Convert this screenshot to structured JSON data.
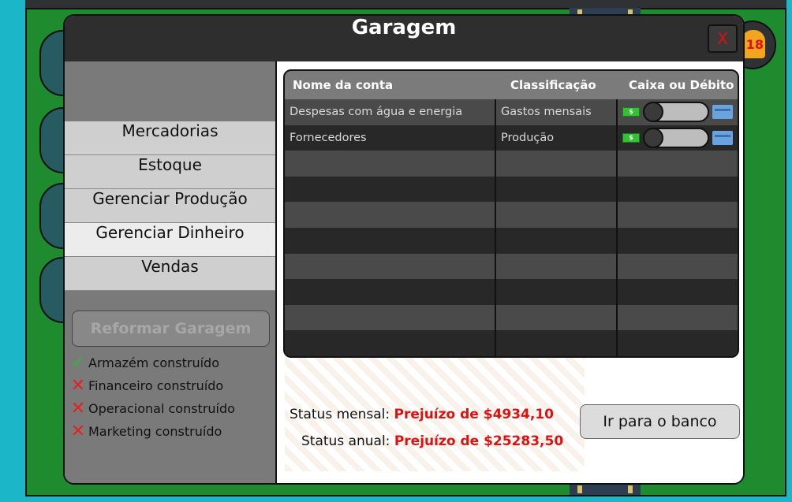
{
  "modal": {
    "title": "Garagem",
    "close_label": "X"
  },
  "notification": {
    "count": "18"
  },
  "sidebar": {
    "menu": [
      {
        "label": "Mercadorias",
        "active": false
      },
      {
        "label": "Estoque",
        "active": false
      },
      {
        "label": "Gerenciar Produção",
        "active": false
      },
      {
        "label": "Gerenciar Dinheiro",
        "active": true
      },
      {
        "label": "Vendas",
        "active": false
      }
    ],
    "reform_button": "Reformar Garagem",
    "checklist": [
      {
        "label": "Armazém construído",
        "done": true
      },
      {
        "label": "Financeiro construído",
        "done": false
      },
      {
        "label": "Operacional construído",
        "done": false
      },
      {
        "label": "Marketing construído",
        "done": false
      }
    ]
  },
  "accounts_table": {
    "headers": [
      "Nome da conta",
      "Classificação",
      "Caixa ou Débito"
    ],
    "rows": [
      {
        "name": "Despesas com água e energia",
        "classification": "Gastos mensais",
        "toggle": true
      },
      {
        "name": "Fornecedores",
        "classification": "Produção",
        "toggle": true
      },
      {
        "name": "",
        "classification": "",
        "toggle": false
      },
      {
        "name": "",
        "classification": "",
        "toggle": false
      },
      {
        "name": "",
        "classification": "",
        "toggle": false
      },
      {
        "name": "",
        "classification": "",
        "toggle": false
      },
      {
        "name": "",
        "classification": "",
        "toggle": false
      },
      {
        "name": "",
        "classification": "",
        "toggle": false
      },
      {
        "name": "",
        "classification": "",
        "toggle": false
      },
      {
        "name": "",
        "classification": "",
        "toggle": false
      }
    ],
    "money_icon": "$",
    "icons": [
      "cash-icon",
      "credit-card-icon"
    ]
  },
  "status": {
    "monthly_label": "Status mensal:",
    "monthly_value": "Prejuízo de $4934,10",
    "annual_label": "Status anual:",
    "annual_value": "Prejuízo de $25283,50"
  },
  "bank_button": "Ir para o banco",
  "colors": {
    "accent_red": "#e01010",
    "ok_green": "#36b536",
    "game_green": "#1e8c2e",
    "background_cyan": "#1bb6c8"
  }
}
